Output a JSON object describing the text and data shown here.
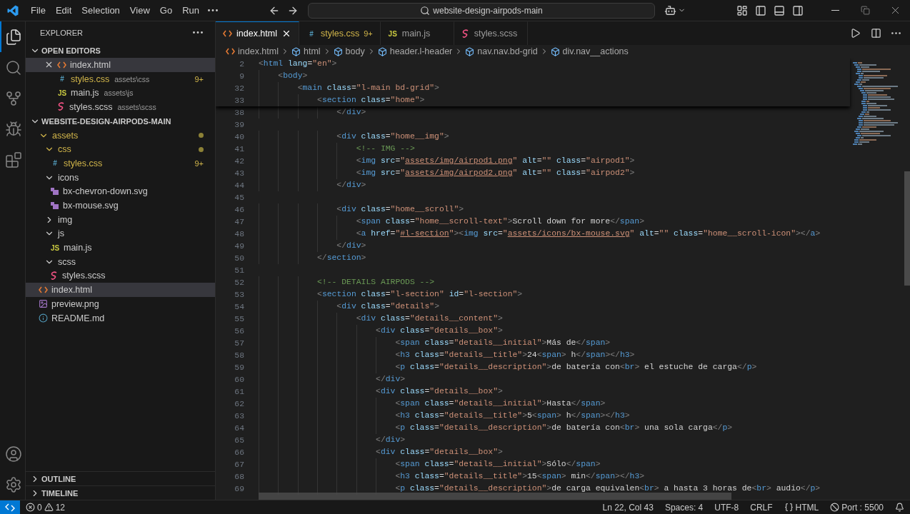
{
  "title_bar": {
    "menu": [
      "File",
      "Edit",
      "Selection",
      "View",
      "Go",
      "Run"
    ],
    "command_center": "website-design-airpods-main"
  },
  "activity_bar": [
    {
      "kind": "explorer",
      "selected": true
    },
    {
      "kind": "search",
      "selected": false
    },
    {
      "kind": "source_control",
      "selected": false
    },
    {
      "kind": "debug",
      "selected": false
    },
    {
      "kind": "extensions",
      "selected": false
    }
  ],
  "explorer": {
    "title": "EXPLORER",
    "open_editors": {
      "title": "OPEN EDITORS",
      "expanded": true,
      "items": [
        {
          "name": "index.html",
          "kind": "html",
          "selected": true,
          "modified": false
        },
        {
          "name": "styles.css",
          "kind": "css",
          "icon_text": "#",
          "path": "assets\\css",
          "badge": "9+",
          "selected": false,
          "modified": true
        },
        {
          "name": "main.js",
          "kind": "js",
          "icon_text": "JS",
          "path": "assets\\js",
          "selected": false,
          "modified": false
        },
        {
          "name": "styles.scss",
          "kind": "scss",
          "path": "assets\\scss",
          "selected": false,
          "modified": false
        }
      ]
    },
    "folder": {
      "title": "WEBSITE-DESIGN-AIRPODS-MAIN",
      "expanded": true,
      "items": [
        {
          "name": "assets",
          "kind": "folder",
          "expanded": true,
          "selected": false,
          "modified": true,
          "children": [
            {
              "name": "css",
              "kind": "folder",
              "expanded": true,
              "selected": false,
              "modified": true,
              "children": [
                {
                  "name": "styles.css",
                  "kind": "css",
                  "icon_text": "#",
                  "badge": "9+",
                  "selected": false,
                  "modified": true
                }
              ]
            },
            {
              "name": "icons",
              "kind": "folder",
              "expanded": true,
              "selected": false,
              "modified": false,
              "children": [
                {
                  "name": "bx-chevron-down.svg",
                  "kind": "svg",
                  "selected": false,
                  "modified": false
                },
                {
                  "name": "bx-mouse.svg",
                  "kind": "svg",
                  "selected": false,
                  "modified": false
                }
              ]
            },
            {
              "name": "img",
              "kind": "folder",
              "expanded": false,
              "selected": false,
              "modified": false
            },
            {
              "name": "js",
              "kind": "folder",
              "expanded": true,
              "selected": false,
              "modified": false,
              "children": [
                {
                  "name": "main.js",
                  "kind": "js",
                  "icon_text": "JS",
                  "selected": false,
                  "modified": false
                }
              ]
            },
            {
              "name": "scss",
              "kind": "folder",
              "expanded": true,
              "selected": false,
              "modified": false,
              "children": [
                {
                  "name": "styles.scss",
                  "kind": "scss",
                  "selected": false,
                  "modified": false
                }
              ]
            }
          ]
        },
        {
          "name": "index.html",
          "kind": "html",
          "selected": true,
          "modified": false
        },
        {
          "name": "preview.png",
          "kind": "png",
          "selected": false,
          "modified": false
        },
        {
          "name": "README.md",
          "kind": "md",
          "selected": false,
          "modified": false
        }
      ]
    },
    "sections": [
      {
        "title": "OUTLINE",
        "expanded": false
      },
      {
        "title": "TIMELINE",
        "expanded": false
      }
    ]
  },
  "tabs": [
    {
      "label": "index.html",
      "kind": "html",
      "selected": true,
      "modified": false
    },
    {
      "label": "styles.css",
      "kind": "css",
      "icon_text": "#",
      "badge": "9+",
      "selected": false,
      "modified": true
    },
    {
      "label": "main.js",
      "kind": "js",
      "icon_text": "JS",
      "selected": false,
      "modified": false
    },
    {
      "label": "styles.scss",
      "kind": "scss",
      "selected": false,
      "modified": false
    }
  ],
  "breadcrumbs": [
    {
      "label": "index.html",
      "kind": "html"
    },
    {
      "label": "html",
      "kind": "element"
    },
    {
      "label": "body",
      "kind": "element"
    },
    {
      "label": "header.l-header",
      "kind": "element"
    },
    {
      "label": "nav.nav.bd-grid",
      "kind": "element"
    },
    {
      "label": "div.nav__actions",
      "kind": "element"
    }
  ],
  "editor": {
    "sticky_lines": [
      {
        "number": "2",
        "tokens": [
          {
            "p": "<"
          },
          {
            "tag": "html"
          },
          {
            "attr": " lang"
          },
          {
            "op": "="
          },
          {
            "str": "\"en\""
          },
          {
            "p": ">"
          }
        ]
      },
      {
        "number": "9",
        "tokens": [
          {
            "p": "    <"
          },
          {
            "tag": "body"
          },
          {
            "p": ">"
          }
        ]
      },
      {
        "number": "32",
        "tokens": [
          {
            "p": "        <"
          },
          {
            "tag": "main"
          },
          {
            "attr": " class"
          },
          {
            "op": "="
          },
          {
            "str": "\"l-main bd-grid\""
          },
          {
            "p": ">"
          }
        ]
      },
      {
        "number": "33",
        "tokens": [
          {
            "p": "            <"
          },
          {
            "tag": "section"
          },
          {
            "attr": " class"
          },
          {
            "op": "="
          },
          {
            "str": "\"home\""
          },
          {
            "p": ">"
          }
        ]
      }
    ],
    "lines": [
      {
        "number": "38",
        "tokens": [
          {
            "p": "                </"
          },
          {
            "tag": "div"
          },
          {
            "p": ">"
          }
        ]
      },
      {
        "number": "39"
      },
      {
        "number": "40",
        "tokens": [
          {
            "p": "                <"
          },
          {
            "tag": "div"
          },
          {
            "attr": " class"
          },
          {
            "op": "="
          },
          {
            "str": "\"home__img\""
          },
          {
            "p": ">"
          }
        ]
      },
      {
        "number": "41",
        "tokens": [
          {
            "com": "                    <!-- IMG -->"
          }
        ]
      },
      {
        "number": "42",
        "tokens": [
          {
            "p": "                    <"
          },
          {
            "tag": "img"
          },
          {
            "attr": " src"
          },
          {
            "op": "="
          },
          {
            "str": "\""
          },
          {
            "link": "assets/img/airpod1.png"
          },
          {
            "str": "\""
          },
          {
            "attr": " alt"
          },
          {
            "op": "="
          },
          {
            "str": "\"\""
          },
          {
            "attr": " class"
          },
          {
            "op": "="
          },
          {
            "str": "\"airpod1\""
          },
          {
            "p": ">"
          }
        ]
      },
      {
        "number": "43",
        "tokens": [
          {
            "p": "                    <"
          },
          {
            "tag": "img"
          },
          {
            "attr": " src"
          },
          {
            "op": "="
          },
          {
            "str": "\""
          },
          {
            "link": "assets/img/airpod2.png"
          },
          {
            "str": "\""
          },
          {
            "attr": " alt"
          },
          {
            "op": "="
          },
          {
            "str": "\"\""
          },
          {
            "attr": " class"
          },
          {
            "op": "="
          },
          {
            "str": "\"airpod2\""
          },
          {
            "p": ">"
          }
        ]
      },
      {
        "number": "44",
        "tokens": [
          {
            "p": "                </"
          },
          {
            "tag": "div"
          },
          {
            "p": ">"
          }
        ]
      },
      {
        "number": "45"
      },
      {
        "number": "46",
        "tokens": [
          {
            "p": "                <"
          },
          {
            "tag": "div"
          },
          {
            "attr": " class"
          },
          {
            "op": "="
          },
          {
            "str": "\"home__scroll\""
          },
          {
            "p": ">"
          }
        ]
      },
      {
        "number": "47",
        "tokens": [
          {
            "p": "                    <"
          },
          {
            "tag": "span"
          },
          {
            "attr": " class"
          },
          {
            "op": "="
          },
          {
            "str": "\"home__scroll-text\""
          },
          {
            "p": ">"
          },
          {
            "txt": "Scroll down for more"
          },
          {
            "p": "</"
          },
          {
            "tag": "span"
          },
          {
            "p": ">"
          }
        ]
      },
      {
        "number": "48",
        "tokens": [
          {
            "p": "                    <"
          },
          {
            "tag": "a"
          },
          {
            "attr": " href"
          },
          {
            "op": "="
          },
          {
            "str": "\""
          },
          {
            "link": "#l-section"
          },
          {
            "str": "\""
          },
          {
            "p": "><"
          },
          {
            "tag": "img"
          },
          {
            "attr": " src"
          },
          {
            "op": "="
          },
          {
            "str": "\""
          },
          {
            "link": "assets/icons/bx-mouse.svg"
          },
          {
            "str": "\""
          },
          {
            "attr": " alt"
          },
          {
            "op": "="
          },
          {
            "str": "\"\""
          },
          {
            "attr": " class"
          },
          {
            "op": "="
          },
          {
            "str": "\"home__scroll-icon\""
          },
          {
            "p": "></"
          },
          {
            "tag": "a"
          },
          {
            "p": ">"
          }
        ]
      },
      {
        "number": "49",
        "tokens": [
          {
            "p": "                </"
          },
          {
            "tag": "div"
          },
          {
            "p": ">"
          }
        ]
      },
      {
        "number": "50",
        "tokens": [
          {
            "p": "            </"
          },
          {
            "tag": "section"
          },
          {
            "p": ">"
          }
        ]
      },
      {
        "number": "51"
      },
      {
        "number": "52",
        "tokens": [
          {
            "com": "            <!-- DETAILS AIRPODS -->"
          }
        ]
      },
      {
        "number": "53",
        "tokens": [
          {
            "p": "            <"
          },
          {
            "tag": "section"
          },
          {
            "attr": " class"
          },
          {
            "op": "="
          },
          {
            "str": "\"l-section\""
          },
          {
            "attr": " id"
          },
          {
            "op": "="
          },
          {
            "str": "\"l-section\""
          },
          {
            "p": ">"
          }
        ]
      },
      {
        "number": "54",
        "tokens": [
          {
            "p": "                <"
          },
          {
            "tag": "div"
          },
          {
            "attr": " class"
          },
          {
            "op": "="
          },
          {
            "str": "\"details\""
          },
          {
            "p": ">"
          }
        ]
      },
      {
        "number": "55",
        "tokens": [
          {
            "p": "                    <"
          },
          {
            "tag": "div"
          },
          {
            "attr": " class"
          },
          {
            "op": "="
          },
          {
            "str": "\"details__content\""
          },
          {
            "p": ">"
          }
        ]
      },
      {
        "number": "56",
        "tokens": [
          {
            "p": "                        <"
          },
          {
            "tag": "div"
          },
          {
            "attr": " class"
          },
          {
            "op": "="
          },
          {
            "str": "\"details__box\""
          },
          {
            "p": ">"
          }
        ]
      },
      {
        "number": "57",
        "tokens": [
          {
            "p": "                            <"
          },
          {
            "tag": "span"
          },
          {
            "attr": " class"
          },
          {
            "op": "="
          },
          {
            "str": "\"details__initial\""
          },
          {
            "p": ">"
          },
          {
            "txt": "Más de"
          },
          {
            "p": "</"
          },
          {
            "tag": "span"
          },
          {
            "p": ">"
          }
        ]
      },
      {
        "number": "58",
        "tokens": [
          {
            "p": "                            <"
          },
          {
            "tag": "h3"
          },
          {
            "attr": " class"
          },
          {
            "op": "="
          },
          {
            "str": "\"details__title\""
          },
          {
            "p": ">"
          },
          {
            "txt": "24"
          },
          {
            "p": "<"
          },
          {
            "tag": "span"
          },
          {
            "p": ">"
          },
          {
            "txt": " h"
          },
          {
            "p": "</"
          },
          {
            "tag": "span"
          },
          {
            "p": "></"
          },
          {
            "tag": "h3"
          },
          {
            "p": ">"
          }
        ]
      },
      {
        "number": "59",
        "tokens": [
          {
            "p": "                            <"
          },
          {
            "tag": "p"
          },
          {
            "attr": " class"
          },
          {
            "op": "="
          },
          {
            "str": "\"details__description\""
          },
          {
            "p": ">"
          },
          {
            "txt": "de batería con"
          },
          {
            "p": "<"
          },
          {
            "tag": "br"
          },
          {
            "p": ">"
          },
          {
            "txt": " el estuche de carga"
          },
          {
            "p": "</"
          },
          {
            "tag": "p"
          },
          {
            "p": ">"
          }
        ]
      },
      {
        "number": "60",
        "tokens": [
          {
            "p": "                        </"
          },
          {
            "tag": "div"
          },
          {
            "p": ">"
          }
        ]
      },
      {
        "number": "61",
        "tokens": [
          {
            "p": "                        <"
          },
          {
            "tag": "div"
          },
          {
            "attr": " class"
          },
          {
            "op": "="
          },
          {
            "str": "\"details__box\""
          },
          {
            "p": ">"
          }
        ]
      },
      {
        "number": "62",
        "tokens": [
          {
            "p": "                            <"
          },
          {
            "tag": "span"
          },
          {
            "attr": " class"
          },
          {
            "op": "="
          },
          {
            "str": "\"details__initial\""
          },
          {
            "p": ">"
          },
          {
            "txt": "Hasta"
          },
          {
            "p": "</"
          },
          {
            "tag": "span"
          },
          {
            "p": ">"
          }
        ]
      },
      {
        "number": "63",
        "tokens": [
          {
            "p": "                            <"
          },
          {
            "tag": "h3"
          },
          {
            "attr": " class"
          },
          {
            "op": "="
          },
          {
            "str": "\"details__title\""
          },
          {
            "p": ">"
          },
          {
            "txt": "5"
          },
          {
            "p": "<"
          },
          {
            "tag": "span"
          },
          {
            "p": ">"
          },
          {
            "txt": " h"
          },
          {
            "p": "</"
          },
          {
            "tag": "span"
          },
          {
            "p": "></"
          },
          {
            "tag": "h3"
          },
          {
            "p": ">"
          }
        ]
      },
      {
        "number": "64",
        "tokens": [
          {
            "p": "                            <"
          },
          {
            "tag": "p"
          },
          {
            "attr": " class"
          },
          {
            "op": "="
          },
          {
            "str": "\"details__description\""
          },
          {
            "p": ">"
          },
          {
            "txt": "de batería con"
          },
          {
            "p": "<"
          },
          {
            "tag": "br"
          },
          {
            "p": ">"
          },
          {
            "txt": " una sola carga"
          },
          {
            "p": "</"
          },
          {
            "tag": "p"
          },
          {
            "p": ">"
          }
        ]
      },
      {
        "number": "65",
        "tokens": [
          {
            "p": "                        </"
          },
          {
            "tag": "div"
          },
          {
            "p": ">"
          }
        ]
      },
      {
        "number": "66",
        "tokens": [
          {
            "p": "                        <"
          },
          {
            "tag": "div"
          },
          {
            "attr": " class"
          },
          {
            "op": "="
          },
          {
            "str": "\"details__box\""
          },
          {
            "p": ">"
          }
        ]
      },
      {
        "number": "67",
        "tokens": [
          {
            "p": "                            <"
          },
          {
            "tag": "span"
          },
          {
            "attr": " class"
          },
          {
            "op": "="
          },
          {
            "str": "\"details__initial\""
          },
          {
            "p": ">"
          },
          {
            "txt": "Sólo"
          },
          {
            "p": "</"
          },
          {
            "tag": "span"
          },
          {
            "p": ">"
          }
        ]
      },
      {
        "number": "68",
        "tokens": [
          {
            "p": "                            <"
          },
          {
            "tag": "h3"
          },
          {
            "attr": " class"
          },
          {
            "op": "="
          },
          {
            "str": "\"details__title\""
          },
          {
            "p": ">"
          },
          {
            "txt": "15"
          },
          {
            "p": "<"
          },
          {
            "tag": "span"
          },
          {
            "p": ">"
          },
          {
            "txt": " min"
          },
          {
            "p": "</"
          },
          {
            "tag": "span"
          },
          {
            "p": "></"
          },
          {
            "tag": "h3"
          },
          {
            "p": ">"
          }
        ]
      },
      {
        "number": "69",
        "tokens": [
          {
            "p": "                            <"
          },
          {
            "tag": "p"
          },
          {
            "attr": " class"
          },
          {
            "op": "="
          },
          {
            "str": "\"details__description\""
          },
          {
            "p": ">"
          },
          {
            "txt": "de carga equivalen"
          },
          {
            "p": "<"
          },
          {
            "tag": "br"
          },
          {
            "p": ">"
          },
          {
            "txt": " a hasta 3 horas de"
          },
          {
            "p": "<"
          },
          {
            "tag": "br"
          },
          {
            "p": ">"
          },
          {
            "txt": " audio"
          },
          {
            "p": "</"
          },
          {
            "tag": "p"
          },
          {
            "p": ">"
          }
        ]
      }
    ]
  },
  "status_bar": {
    "errors": "0",
    "warnings": "12",
    "items": [
      {
        "kind": "text",
        "label": "Ln 22, Col 43"
      },
      {
        "kind": "text",
        "label": "Spaces: 4"
      },
      {
        "kind": "text",
        "label": "UTF-8"
      },
      {
        "kind": "text",
        "label": "CRLF"
      },
      {
        "kind": "language",
        "label": "HTML"
      },
      {
        "kind": "port",
        "label": "Port : 5500"
      },
      {
        "kind": "notifications"
      }
    ]
  }
}
